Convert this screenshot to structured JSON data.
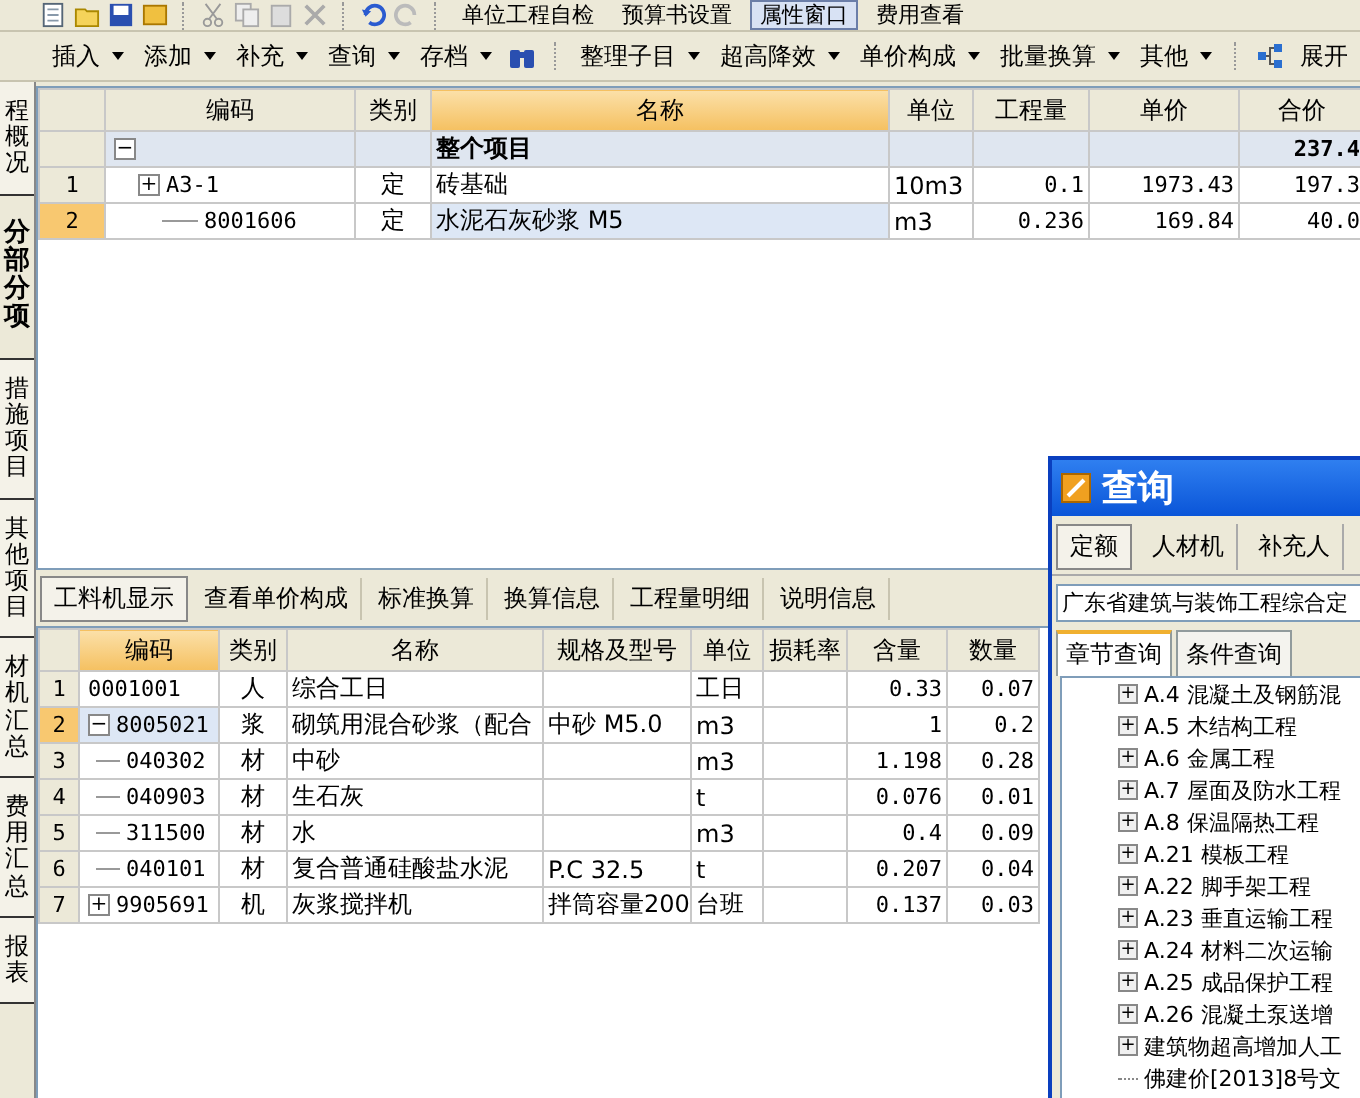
{
  "top_toolbar": [
    {
      "label": "单位工程自检",
      "selected": false
    },
    {
      "label": "预算书设置",
      "selected": false
    },
    {
      "label": "属性窗口",
      "selected": true
    },
    {
      "label": "费用查看",
      "selected": false
    }
  ],
  "toolbar": {
    "left_menus": [
      "插入",
      "添加",
      "补充",
      "查询",
      "存档"
    ],
    "right_menus": [
      "整理子目",
      "超高降效",
      "单价构成",
      "批量换算",
      "其他"
    ],
    "expand": "展开"
  },
  "side_tabs": [
    {
      "label": "程概况",
      "selected": false
    },
    {
      "label": "分部分项",
      "selected": true
    },
    {
      "label": "措施项目",
      "selected": false
    },
    {
      "label": "其他项目",
      "selected": false
    },
    {
      "label": "材机汇总",
      "selected": false
    },
    {
      "label": "费用汇总",
      "selected": false
    },
    {
      "label": "报表",
      "selected": false
    }
  ],
  "upper_table": {
    "columns": [
      {
        "label": "编码",
        "selected": false
      },
      {
        "label": "类别",
        "selected": false
      },
      {
        "label": "名称",
        "selected": true
      },
      {
        "label": "单位",
        "selected": false
      },
      {
        "label": "工程量",
        "selected": false
      },
      {
        "label": "单价",
        "selected": false
      },
      {
        "label": "合价",
        "selected": false
      }
    ],
    "rows": [
      {
        "kind": "summary",
        "toggle": "−",
        "name": "整个项目",
        "total": "237.4",
        "children": [
          {
            "num": "1",
            "toggle": "+",
            "code": "A3-1",
            "type": "定",
            "name": "砖基础",
            "unit": "10m3",
            "quantity": "0.1",
            "price": "1973.43",
            "total": "197.3",
            "selected": false,
            "children": [
              {
                "num": "2",
                "code": "8001606",
                "type": "定",
                "name": "水泥石灰砂浆 M5",
                "unit": "m3",
                "quantity": "0.236",
                "price": "169.84",
                "total": "40.0",
                "selected": true
              }
            ]
          }
        ]
      }
    ]
  },
  "bottom_tabs": [
    {
      "label": "工料机显示",
      "selected": true
    },
    {
      "label": "查看单价构成",
      "selected": false
    },
    {
      "label": "标准换算",
      "selected": false
    },
    {
      "label": "换算信息",
      "selected": false
    },
    {
      "label": "工程量明细",
      "selected": false
    },
    {
      "label": "说明信息",
      "selected": false
    }
  ],
  "lower_table": {
    "columns": [
      {
        "label": "编码",
        "selected": true
      },
      {
        "label": "类别",
        "selected": false
      },
      {
        "label": "名称",
        "selected": false
      },
      {
        "label": "规格及型号",
        "selected": false
      },
      {
        "label": "单位",
        "selected": false
      },
      {
        "label": "损耗率",
        "selected": false
      },
      {
        "label": "含量",
        "selected": false
      },
      {
        "label": "数量",
        "selected": false
      }
    ],
    "rows": [
      {
        "num": "1",
        "code": "0001001",
        "type": "人",
        "name": "综合工日",
        "unit": "工日",
        "content": "0.33",
        "qty": "0.07",
        "selected": false
      },
      {
        "num": "2",
        "toggle": "−",
        "code": "8005021",
        "type": "浆",
        "name": "砌筑用混合砂浆（配合",
        "spec": "中砂 M5.0",
        "unit": "m3",
        "content": "1",
        "qty": "0.2",
        "selected": true,
        "children": [
          {
            "num": "3",
            "code": "040302",
            "type": "材",
            "name": "中砂",
            "unit": "m3",
            "content": "1.198",
            "qty": "0.28",
            "selected": false
          },
          {
            "num": "4",
            "code": "040903",
            "type": "材",
            "name": "生石灰",
            "unit": "t",
            "content": "0.076",
            "qty": "0.01",
            "selected": false
          },
          {
            "num": "5",
            "code": "311500",
            "type": "材",
            "name": "水",
            "unit": "m3",
            "content": "0.4",
            "qty": "0.09",
            "selected": false
          },
          {
            "num": "6",
            "code": "040101",
            "type": "材",
            "name": "复合普通硅酸盐水泥",
            "spec": "P.C 32.5",
            "unit": "t",
            "content": "0.207",
            "qty": "0.04",
            "selected": false
          }
        ]
      },
      {
        "num": "7",
        "toggle": "+",
        "code": "9905691",
        "type": "机",
        "name": "灰浆搅拌机",
        "spec": "拌筒容量200",
        "unit": "台班",
        "content": "0.137",
        "qty": "0.03",
        "selected": false
      }
    ]
  },
  "dialog": {
    "title": "查询",
    "tabs": [
      {
        "label": "定额",
        "selected": true
      },
      {
        "label": "人材机",
        "selected": false
      },
      {
        "label": "补充人",
        "selected": false
      }
    ],
    "library": "广东省建筑与装饰工程综合定",
    "subtabs": [
      {
        "label": "章节查询",
        "selected": true
      },
      {
        "label": "条件查询",
        "selected": false
      }
    ],
    "tree": [
      {
        "label": "A.4 混凝土及钢筋混",
        "toggle": "+"
      },
      {
        "label": "A.5 木结构工程",
        "toggle": "+"
      },
      {
        "label": "A.6 金属工程",
        "toggle": "+"
      },
      {
        "label": "A.7 屋面及防水工程",
        "toggle": "+"
      },
      {
        "label": "A.8 保温隔热工程",
        "toggle": "+"
      },
      {
        "label": "A.21 模板工程",
        "toggle": "+"
      },
      {
        "label": "A.22 脚手架工程",
        "toggle": "+"
      },
      {
        "label": "A.23 垂直运输工程",
        "toggle": "+"
      },
      {
        "label": "A.24 材料二次运输",
        "toggle": "+"
      },
      {
        "label": "A.25 成品保护工程",
        "toggle": "+"
      },
      {
        "label": "A.26 混凝土泵送增",
        "toggle": "+"
      },
      {
        "label": "建筑物超高增加人工",
        "toggle": "+"
      },
      {
        "label": "佛建价[2013]8号文"
      }
    ]
  }
}
